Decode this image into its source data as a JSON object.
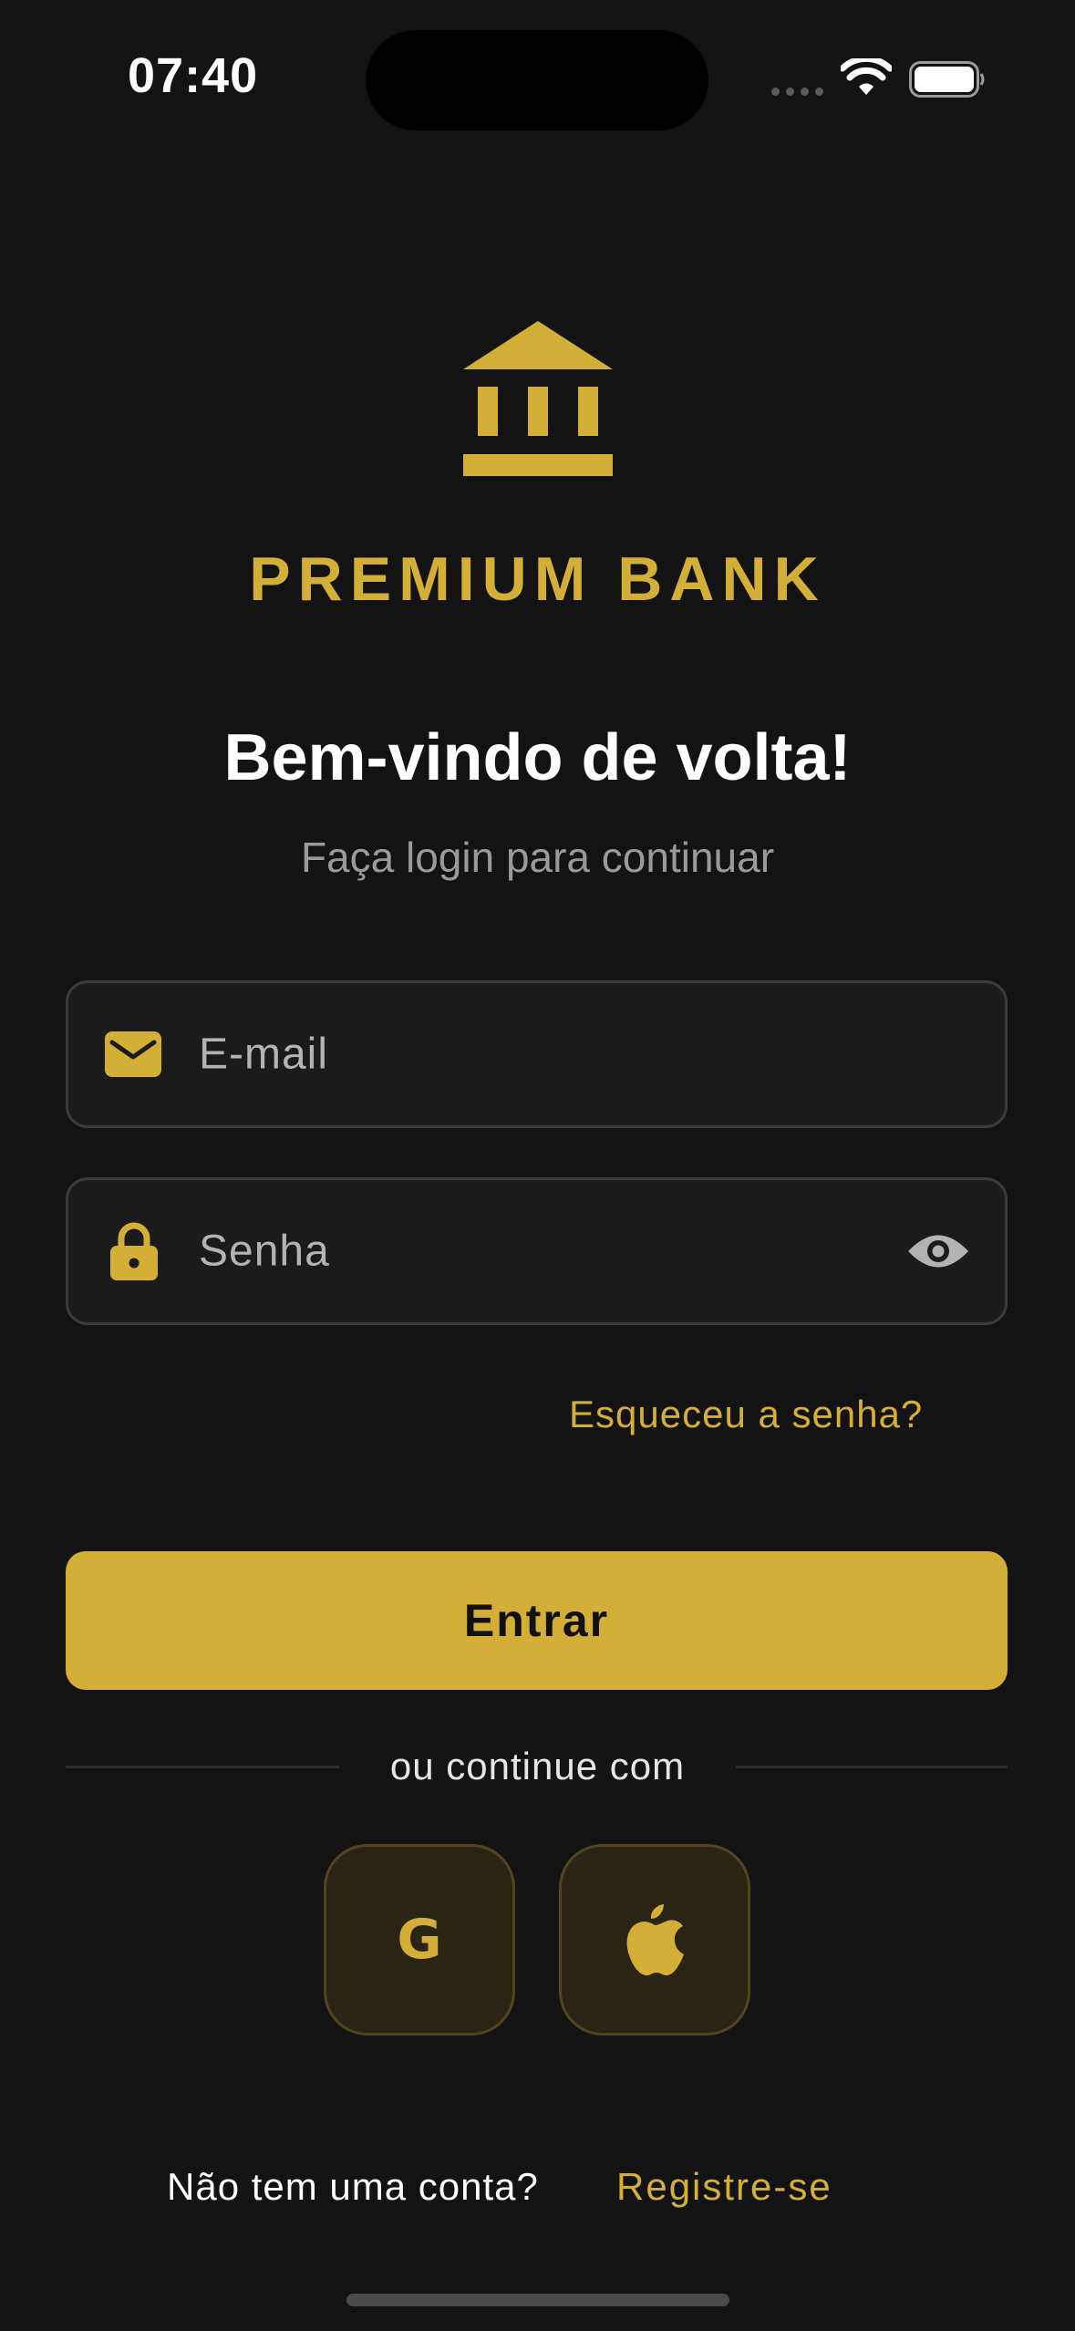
{
  "status_bar": {
    "time": "07:40"
  },
  "brand": {
    "name": "PREMIUM BANK",
    "icon": "bank-icon",
    "accent_color": "#d4af37"
  },
  "header": {
    "title": "Bem-vindo de volta!",
    "subtitle": "Faça login para continuar"
  },
  "form": {
    "email": {
      "placeholder": "E-mail",
      "value": "",
      "icon": "envelope-icon"
    },
    "password": {
      "placeholder": "Senha",
      "value": "",
      "icon": "lock-icon",
      "toggle_icon": "eye-icon"
    },
    "forgot_label": "Esqueceu a senha?",
    "submit_label": "Entrar"
  },
  "social": {
    "divider_label": "ou continue com",
    "google_label": "G",
    "apple_icon": "apple-icon"
  },
  "footer": {
    "signup_question": "Não tem uma conta?",
    "signup_link": "Registre-se"
  }
}
